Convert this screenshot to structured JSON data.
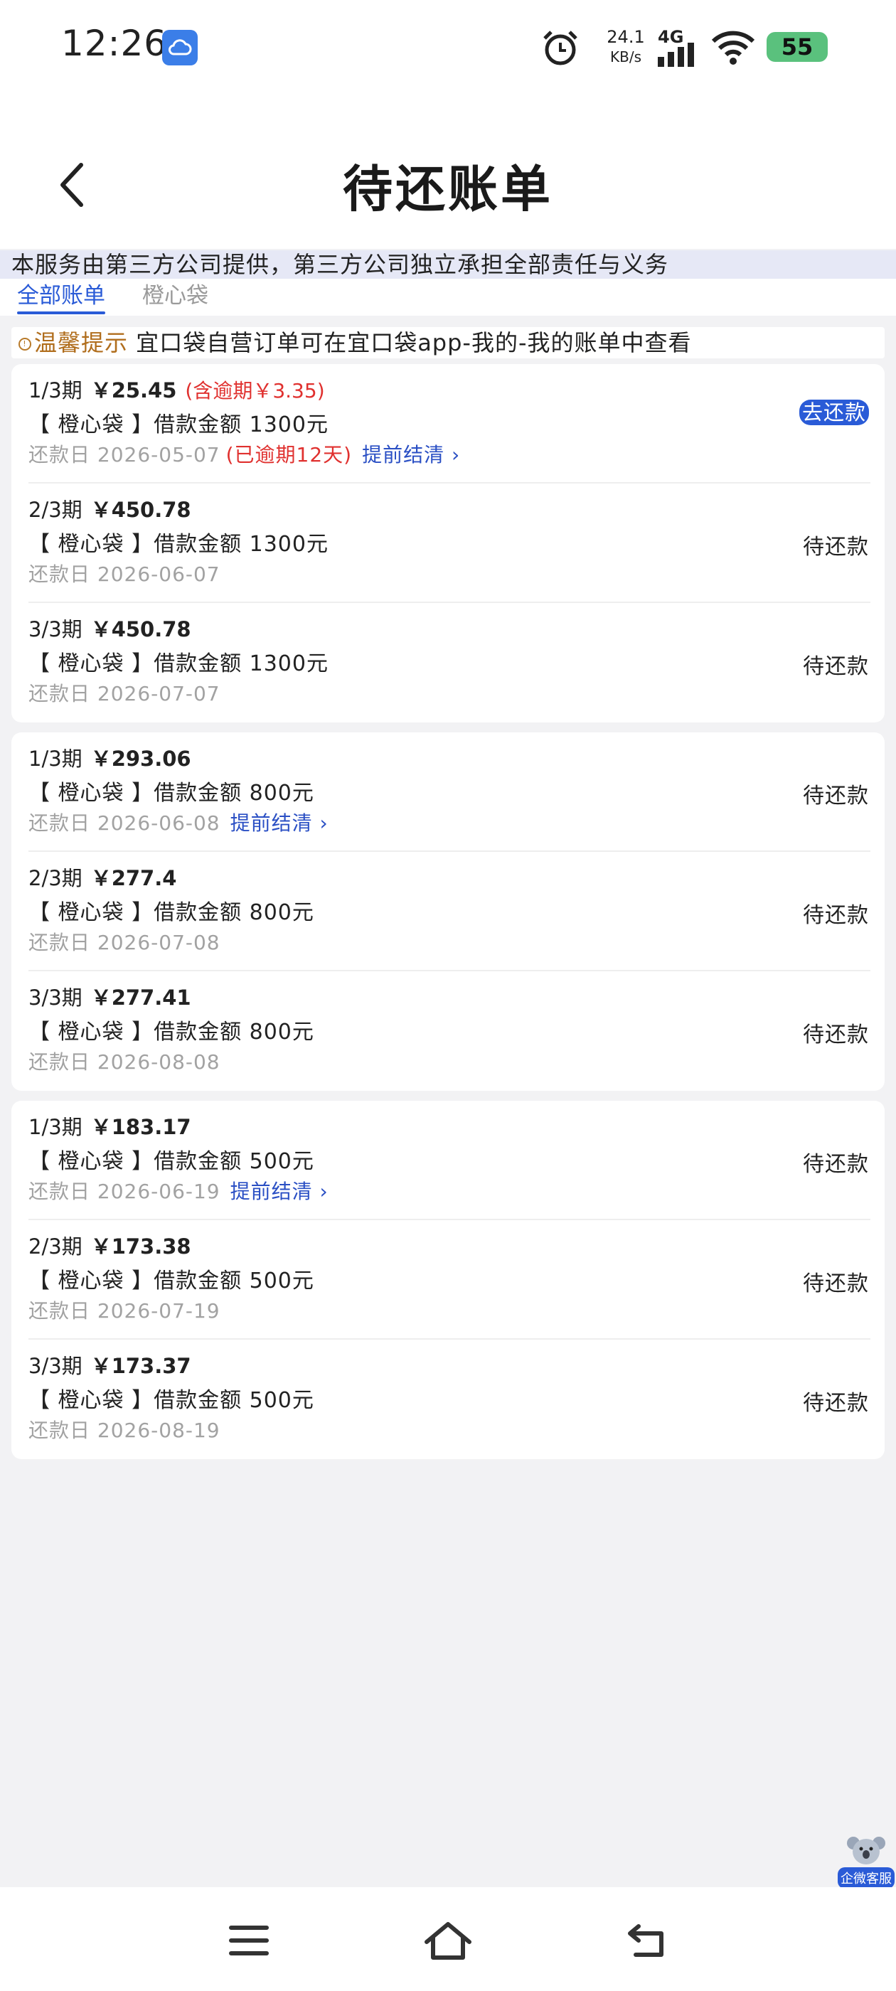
{
  "status_bar": {
    "time": "12:26",
    "net_speed": "24.1",
    "net_unit": "KB/s",
    "network": "4G",
    "battery": "55",
    "icons": [
      "cloud-app-icon",
      "alarm-icon",
      "signal-icon",
      "wifi-icon",
      "battery-icon"
    ]
  },
  "header": {
    "title": "待还账单",
    "back_icon": "chevron-left-icon"
  },
  "notice": "本服务由第三方公司提供，第三方公司独立承担全部责任与义务",
  "tabs": [
    {
      "label": "全部账单",
      "active": true
    },
    {
      "label": "橙心袋",
      "active": false
    }
  ],
  "tip": {
    "label": "温馨提示",
    "text": "宜口袋自营订单可在宜口袋app-我的-我的账单中查看"
  },
  "colors": {
    "accent": "#2a5bd7",
    "overdue": "#e0312f",
    "tip_label": "#b06d1c",
    "notice_bg": "#e6e8f6"
  },
  "loans": [
    {
      "bills": [
        {
          "period": "1/3期",
          "amount": "￥25.45",
          "late_fee": "(含逾期￥3.35)",
          "product": "【 橙心袋 】借款金额 1300元",
          "due_label": "还款日 2026-05-07",
          "overdue": "(已逾期12天)",
          "early": "提前结清 ›",
          "status": "去还款"
        },
        {
          "period": "2/3期",
          "amount": "￥450.78",
          "late_fee": "",
          "product": "【 橙心袋 】借款金额 1300元",
          "due_label": "还款日 2026-06-07",
          "overdue": "",
          "early": "",
          "status": "待还款"
        },
        {
          "period": "3/3期",
          "amount": "￥450.78",
          "late_fee": "",
          "product": "【 橙心袋 】借款金额 1300元",
          "due_label": "还款日 2026-07-07",
          "overdue": "",
          "early": "",
          "status": "待还款"
        }
      ]
    },
    {
      "bills": [
        {
          "period": "1/3期",
          "amount": "￥293.06",
          "late_fee": "",
          "product": "【 橙心袋 】借款金额 800元",
          "due_label": "还款日 2026-06-08",
          "overdue": "",
          "early": "提前结清 ›",
          "status": "待还款"
        },
        {
          "period": "2/3期",
          "amount": "￥277.4",
          "late_fee": "",
          "product": "【 橙心袋 】借款金额 800元",
          "due_label": "还款日 2026-07-08",
          "overdue": "",
          "early": "",
          "status": "待还款"
        },
        {
          "period": "3/3期",
          "amount": "￥277.41",
          "late_fee": "",
          "product": "【 橙心袋 】借款金额 800元",
          "due_label": "还款日 2026-08-08",
          "overdue": "",
          "early": "",
          "status": "待还款"
        }
      ]
    },
    {
      "bills": [
        {
          "period": "1/3期",
          "amount": "￥183.17",
          "late_fee": "",
          "product": "【 橙心袋 】借款金额 500元",
          "due_label": "还款日 2026-06-19",
          "overdue": "",
          "early": "提前结清 ›",
          "status": "待还款"
        },
        {
          "period": "2/3期",
          "amount": "￥173.38",
          "late_fee": "",
          "product": "【 橙心袋 】借款金额 500元",
          "due_label": "还款日 2026-07-19",
          "overdue": "",
          "early": "",
          "status": "待还款"
        },
        {
          "period": "3/3期",
          "amount": "￥173.37",
          "late_fee": "",
          "product": "【 橙心袋 】借款金额 500元",
          "due_label": "还款日 2026-08-19",
          "overdue": "",
          "early": "",
          "status": "待还款"
        }
      ]
    }
  ],
  "service": {
    "label": "企微客服",
    "icon": "koala-icon"
  },
  "nav": {
    "icons": [
      "menu-icon",
      "home-icon",
      "back-icon"
    ]
  }
}
